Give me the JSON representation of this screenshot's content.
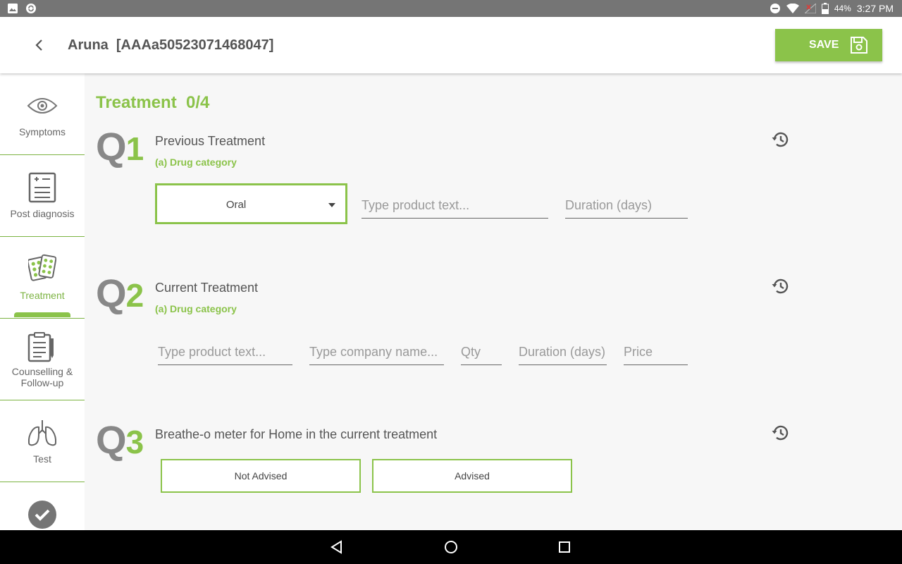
{
  "status_bar": {
    "battery_percent": "44%",
    "time": "3:27 PM"
  },
  "header": {
    "patient_title": "Aruna  [AAAa50523071468047]",
    "save_label": "SAVE"
  },
  "sidebar": {
    "items": [
      {
        "label": "Symptoms",
        "icon": "eye-icon"
      },
      {
        "label": "Post diagnosis",
        "icon": "clipboard-plus-icon"
      },
      {
        "label": "Treatment",
        "icon": "pill-pack-icon"
      },
      {
        "label": "Counselling &",
        "label2": "Follow-up",
        "icon": "clipboard-pen-icon"
      },
      {
        "label": "Test",
        "icon": "lungs-icon"
      },
      {
        "label": "",
        "icon": "check-circle-icon"
      }
    ],
    "active_index": 2
  },
  "main": {
    "section_title": "Treatment  0/4",
    "questions": [
      {
        "q": "Q",
        "num": "1",
        "title": "Previous Treatment",
        "sub": "(a) Drug category",
        "dropdown_value": "Oral",
        "product_placeholder": "Type product text...",
        "duration_placeholder": "Duration (days)"
      },
      {
        "q": "Q",
        "num": "2",
        "title": "Current Treatment",
        "sub": "(a) Drug category",
        "product_placeholder": "Type product text...",
        "company_placeholder": "Type company name...",
        "qty_placeholder": "Qty",
        "duration_placeholder": "Duration (days)",
        "price_placeholder": "Price"
      },
      {
        "q": "Q",
        "num": "3",
        "title": "Breathe-o meter for Home in the current treatment",
        "options": [
          "Not Advised",
          "Advised"
        ]
      }
    ]
  },
  "colors": {
    "accent": "#8bc34a",
    "status_bar": "#757575",
    "nav_bar": "#000000"
  }
}
